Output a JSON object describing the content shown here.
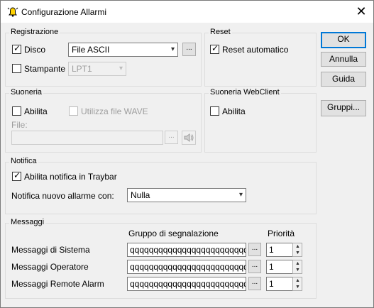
{
  "window": {
    "title": "Configurazione Allarmi"
  },
  "registrazione": {
    "group_label": "Registrazione",
    "disco_label": "Disco",
    "disco_checked": true,
    "disco_format": "File ASCII",
    "browse_label": "...",
    "stampante_label": "Stampante",
    "stampante_checked": false,
    "stampante_port": "LPT1"
  },
  "reset": {
    "group_label": "Reset",
    "auto_label": "Reset automatico",
    "auto_checked": true
  },
  "buttons": {
    "ok": "OK",
    "annulla": "Annulla",
    "guida": "Guida",
    "gruppi": "Gruppi..."
  },
  "suoneria": {
    "group_label": "Suoneria",
    "abilita_label": "Abilita",
    "abilita_checked": false,
    "wave_label": "Utilizza file WAVE",
    "file_label": "File:",
    "file_value": "",
    "browse_label": "..."
  },
  "suoneria_web": {
    "group_label": "Suoneria WebClient",
    "abilita_label": "Abilita",
    "abilita_checked": false
  },
  "notifica": {
    "group_label": "Notifica",
    "traybar_label": "Abilita notifica in Traybar",
    "traybar_checked": true,
    "nuovo_label": "Notifica nuovo allarme con:",
    "nuovo_value": "Nulla"
  },
  "messaggi": {
    "group_label": "Messaggi",
    "col_gruppo": "Gruppo di segnalazione",
    "col_priorita": "Priorità",
    "browse_label": "...",
    "rows": [
      {
        "label": "Messaggi di Sistema",
        "gruppo": "qqqqqqqqqqqqqqqqqqqqqqqqqqqqqq",
        "priorita": "1"
      },
      {
        "label": "Messaggi Operatore",
        "gruppo": "qqqqqqqqqqqqqqqqqqqqqqqqqqqqqq",
        "priorita": "1"
      },
      {
        "label": "Messaggi Remote Alarm",
        "gruppo": "qqqqqqqqqqqqqqqqqqqqqqqqqqqqqq",
        "priorita": "1"
      }
    ]
  },
  "icons": {
    "app": "bell-warning-icon",
    "speaker": "speaker-icon",
    "close": "close-icon"
  }
}
